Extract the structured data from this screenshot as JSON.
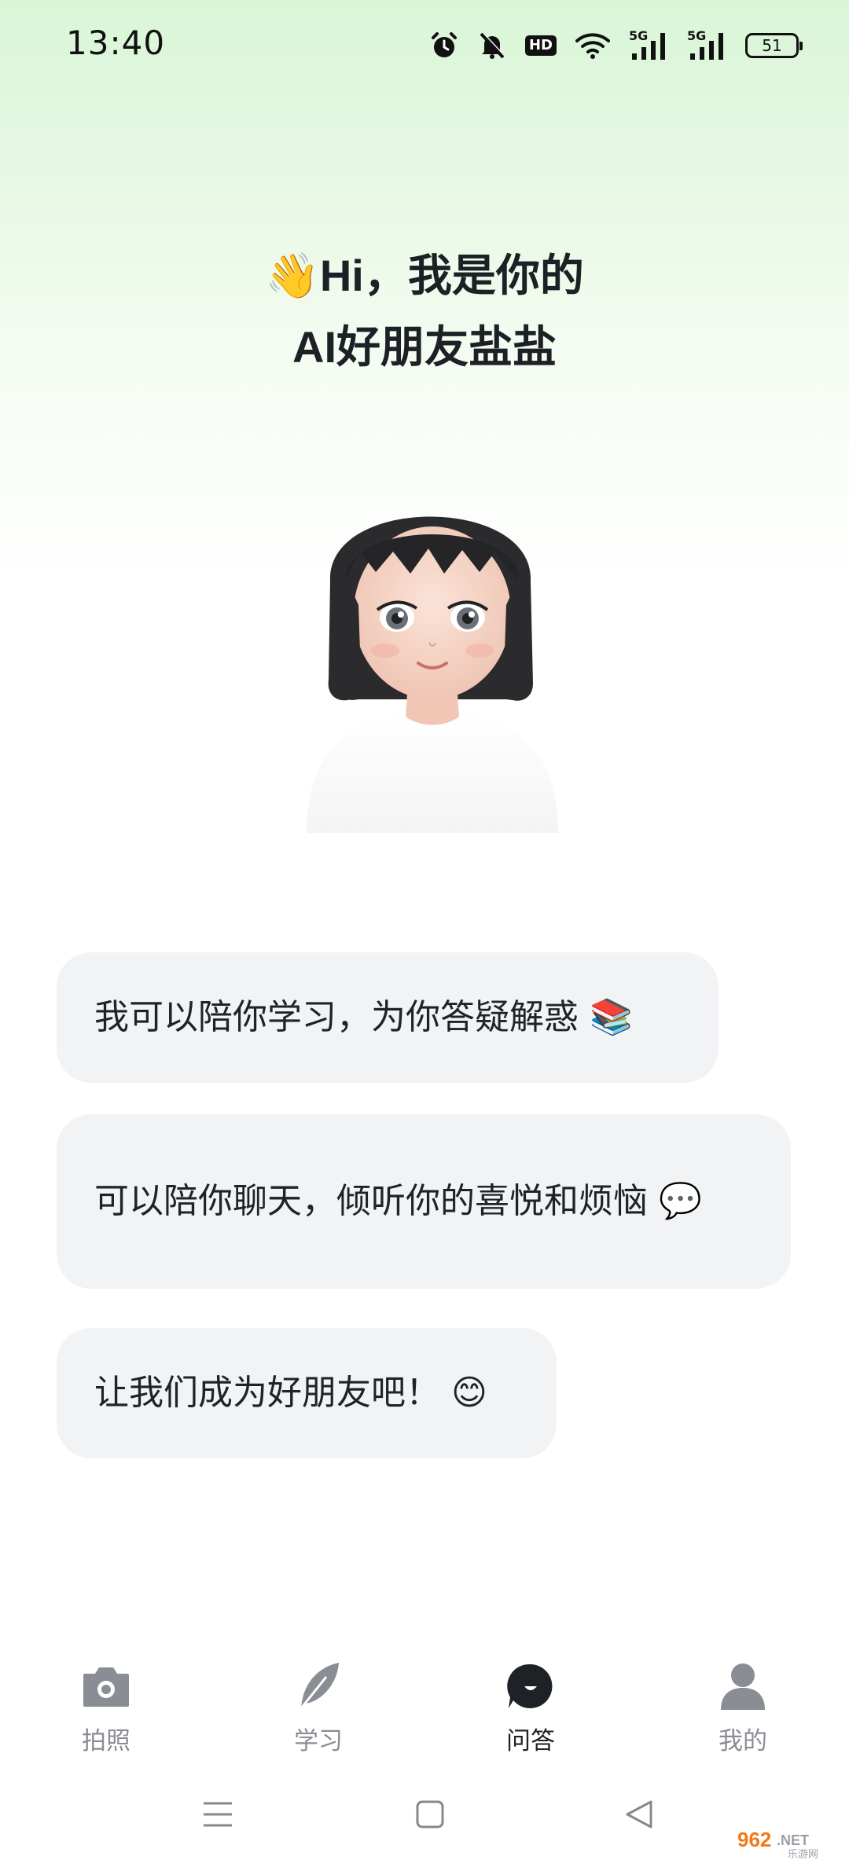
{
  "status_bar": {
    "time": "13:40",
    "hd_label": "HD",
    "network_1": "5G",
    "network_2": "5G",
    "battery": "51"
  },
  "greeting": {
    "wave_emoji": "👋",
    "line1": "Hi，我是你的",
    "line2": "AI好朋友盐盐"
  },
  "messages": [
    {
      "text": "我可以陪你学习，为你答疑解惑 📚"
    },
    {
      "text": "可以陪你聊天，倾听你的喜悦和烦恼 💬"
    },
    {
      "text": "让我们成为好朋友吧！ 😊"
    }
  ],
  "bottom_nav": {
    "items": [
      {
        "label": "拍照",
        "icon": "camera-icon",
        "active": false
      },
      {
        "label": "学习",
        "icon": "feather-icon",
        "active": false
      },
      {
        "label": "问答",
        "icon": "chat-bubble-icon",
        "active": true
      },
      {
        "label": "我的",
        "icon": "profile-icon",
        "active": false
      }
    ]
  },
  "watermark": {
    "brand": "962",
    "suffix": ".NET",
    "sub": "乐游网"
  },
  "colors": {
    "bg_top": "#d9f5d6",
    "bubble_bg": "#f2f3f5",
    "nav_inactive": "#8a8d93",
    "nav_active": "#222222",
    "watermark_orange": "#f07a1a"
  }
}
